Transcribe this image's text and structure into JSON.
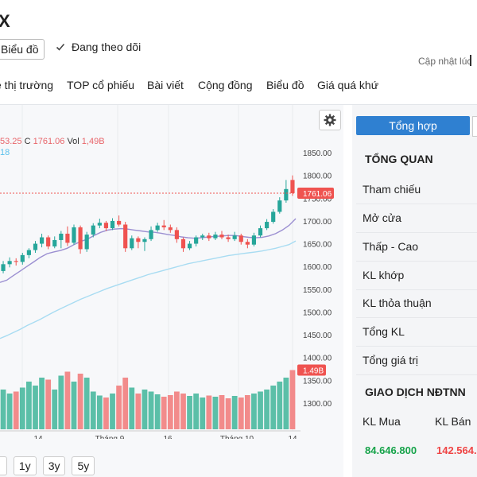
{
  "header": {
    "title": "X",
    "chart_button": "Biểu đồ",
    "follow_label": "Đang theo dõi",
    "updated_label": "Cập nhật lúc"
  },
  "nav": {
    "items": [
      "e thị trường",
      "TOP cổ phiếu",
      "Bài viết",
      "Cộng đồng",
      "Biểu đồ",
      "Giá quá khứ"
    ]
  },
  "chart": {
    "ohlc_prefix": "53.25",
    "close_label": "C",
    "close_value": "1761.06",
    "vol_label": "Vol",
    "vol_value": "1,49B",
    "ma_label": "18",
    "last_price_tag": "1761.06",
    "last_volume_tag": "1.49B",
    "price_axis": [
      "1850.00",
      "1800.00",
      "1750.00",
      "1700.00",
      "1650.00",
      "1600.00",
      "1550.00",
      "1500.00",
      "1450.00",
      "1400.00",
      "1350.00",
      "1300.00"
    ],
    "time_axis": [
      "14",
      "Tháng 9",
      "16",
      "Tháng 10",
      "14"
    ],
    "ranges": [
      "1y",
      "3y",
      "5y"
    ],
    "up_color": "#26a69a",
    "down_color": "#ef5350"
  },
  "chart_data": {
    "type": "candlestick",
    "ylim": [
      1290,
      1860
    ],
    "volume_unit": "B",
    "ma_fast": [
      1565,
      1570,
      1580,
      1590,
      1600,
      1610,
      1620,
      1628,
      1632,
      1635,
      1640,
      1648,
      1655,
      1660,
      1668,
      1675,
      1680,
      1682,
      1683,
      1682,
      1680,
      1678,
      1676,
      1675,
      1673,
      1670,
      1668,
      1665,
      1663,
      1662,
      1663,
      1665,
      1666,
      1667,
      1668,
      1668,
      1666,
      1664,
      1663,
      1664,
      1667,
      1672,
      1680,
      1690,
      1705
    ],
    "ma_slow": [
      1442,
      1448,
      1455,
      1462,
      1470,
      1477,
      1484,
      1492,
      1500,
      1507,
      1514,
      1521,
      1528,
      1534,
      1540,
      1546,
      1552,
      1557,
      1562,
      1567,
      1572,
      1577,
      1582,
      1586,
      1590,
      1594,
      1598,
      1602,
      1606,
      1609,
      1612,
      1615,
      1618,
      1621,
      1624,
      1626,
      1628,
      1630,
      1632,
      1634,
      1637,
      1640,
      1644,
      1648,
      1656
    ],
    "candles": [
      {
        "o": 1590,
        "c": 1605,
        "h": 1612,
        "l": 1585,
        "v": 1.0
      },
      {
        "o": 1605,
        "c": 1612,
        "h": 1620,
        "l": 1598,
        "v": 0.9
      },
      {
        "o": 1612,
        "c": 1610,
        "h": 1618,
        "l": 1602,
        "v": 0.95
      },
      {
        "o": 1610,
        "c": 1625,
        "h": 1630,
        "l": 1604,
        "v": 1.05
      },
      {
        "o": 1625,
        "c": 1636,
        "h": 1640,
        "l": 1618,
        "v": 1.2
      },
      {
        "o": 1636,
        "c": 1650,
        "h": 1656,
        "l": 1630,
        "v": 1.1
      },
      {
        "o": 1650,
        "c": 1664,
        "h": 1672,
        "l": 1642,
        "v": 1.3
      },
      {
        "o": 1664,
        "c": 1644,
        "h": 1668,
        "l": 1638,
        "v": 1.25
      },
      {
        "o": 1644,
        "c": 1658,
        "h": 1666,
        "l": 1640,
        "v": 1.0
      },
      {
        "o": 1658,
        "c": 1672,
        "h": 1678,
        "l": 1640,
        "v": 1.35
      },
      {
        "o": 1672,
        "c": 1652,
        "h": 1688,
        "l": 1645,
        "v": 1.45
      },
      {
        "o": 1652,
        "c": 1686,
        "h": 1692,
        "l": 1648,
        "v": 1.2
      },
      {
        "o": 1686,
        "c": 1638,
        "h": 1690,
        "l": 1628,
        "v": 1.4
      },
      {
        "o": 1638,
        "c": 1670,
        "h": 1676,
        "l": 1632,
        "v": 1.3
      },
      {
        "o": 1670,
        "c": 1690,
        "h": 1695,
        "l": 1664,
        "v": 0.95
      },
      {
        "o": 1690,
        "c": 1696,
        "h": 1705,
        "l": 1684,
        "v": 0.85
      },
      {
        "o": 1696,
        "c": 1684,
        "h": 1700,
        "l": 1678,
        "v": 0.8
      },
      {
        "o": 1684,
        "c": 1700,
        "h": 1706,
        "l": 1680,
        "v": 0.9
      },
      {
        "o": 1700,
        "c": 1692,
        "h": 1712,
        "l": 1688,
        "v": 1.1
      },
      {
        "o": 1692,
        "c": 1640,
        "h": 1698,
        "l": 1632,
        "v": 1.3
      },
      {
        "o": 1640,
        "c": 1662,
        "h": 1668,
        "l": 1636,
        "v": 1.05
      },
      {
        "o": 1662,
        "c": 1654,
        "h": 1666,
        "l": 1640,
        "v": 0.9
      },
      {
        "o": 1654,
        "c": 1660,
        "h": 1664,
        "l": 1634,
        "v": 1.0
      },
      {
        "o": 1660,
        "c": 1680,
        "h": 1688,
        "l": 1656,
        "v": 0.95
      },
      {
        "o": 1680,
        "c": 1690,
        "h": 1696,
        "l": 1676,
        "v": 0.88
      },
      {
        "o": 1690,
        "c": 1686,
        "h": 1702,
        "l": 1680,
        "v": 0.82
      },
      {
        "o": 1686,
        "c": 1680,
        "h": 1692,
        "l": 1674,
        "v": 0.86
      },
      {
        "o": 1680,
        "c": 1660,
        "h": 1686,
        "l": 1652,
        "v": 0.95
      },
      {
        "o": 1660,
        "c": 1640,
        "h": 1664,
        "l": 1632,
        "v": 0.9
      },
      {
        "o": 1640,
        "c": 1650,
        "h": 1656,
        "l": 1636,
        "v": 0.84
      },
      {
        "o": 1650,
        "c": 1664,
        "h": 1668,
        "l": 1644,
        "v": 0.9
      },
      {
        "o": 1664,
        "c": 1668,
        "h": 1672,
        "l": 1658,
        "v": 0.8
      },
      {
        "o": 1668,
        "c": 1662,
        "h": 1674,
        "l": 1656,
        "v": 0.85
      },
      {
        "o": 1662,
        "c": 1670,
        "h": 1676,
        "l": 1658,
        "v": 0.82
      },
      {
        "o": 1670,
        "c": 1664,
        "h": 1678,
        "l": 1660,
        "v": 0.86
      },
      {
        "o": 1664,
        "c": 1660,
        "h": 1670,
        "l": 1654,
        "v": 0.78
      },
      {
        "o": 1660,
        "c": 1668,
        "h": 1676,
        "l": 1656,
        "v": 0.84
      },
      {
        "o": 1668,
        "c": 1654,
        "h": 1672,
        "l": 1648,
        "v": 0.8
      },
      {
        "o": 1654,
        "c": 1648,
        "h": 1660,
        "l": 1640,
        "v": 0.86
      },
      {
        "o": 1648,
        "c": 1668,
        "h": 1674,
        "l": 1644,
        "v": 0.9
      },
      {
        "o": 1668,
        "c": 1684,
        "h": 1690,
        "l": 1664,
        "v": 0.95
      },
      {
        "o": 1684,
        "c": 1698,
        "h": 1704,
        "l": 1680,
        "v": 1.0
      },
      {
        "o": 1698,
        "c": 1720,
        "h": 1726,
        "l": 1694,
        "v": 1.1
      },
      {
        "o": 1720,
        "c": 1745,
        "h": 1752,
        "l": 1716,
        "v": 1.2
      },
      {
        "o": 1745,
        "c": 1770,
        "h": 1790,
        "l": 1740,
        "v": 1.3
      },
      {
        "o": 1790,
        "c": 1761,
        "h": 1800,
        "l": 1755,
        "v": 1.49
      }
    ]
  },
  "panel": {
    "tab_label": "Tổng hợp",
    "overview_title": "TỔNG QUAN",
    "rows": [
      "Tham chiếu",
      "Mở cửa",
      "Thấp - Cao",
      "KL khớp",
      "KL thỏa thuận",
      "Tổng KL",
      "Tổng giá trị"
    ],
    "foreign_title": "GIAO DỊCH NĐTNN",
    "buy_label": "KL Mua",
    "sell_label": "KL Bán",
    "buy_value": "84.646.800",
    "sell_value": "142.564."
  }
}
